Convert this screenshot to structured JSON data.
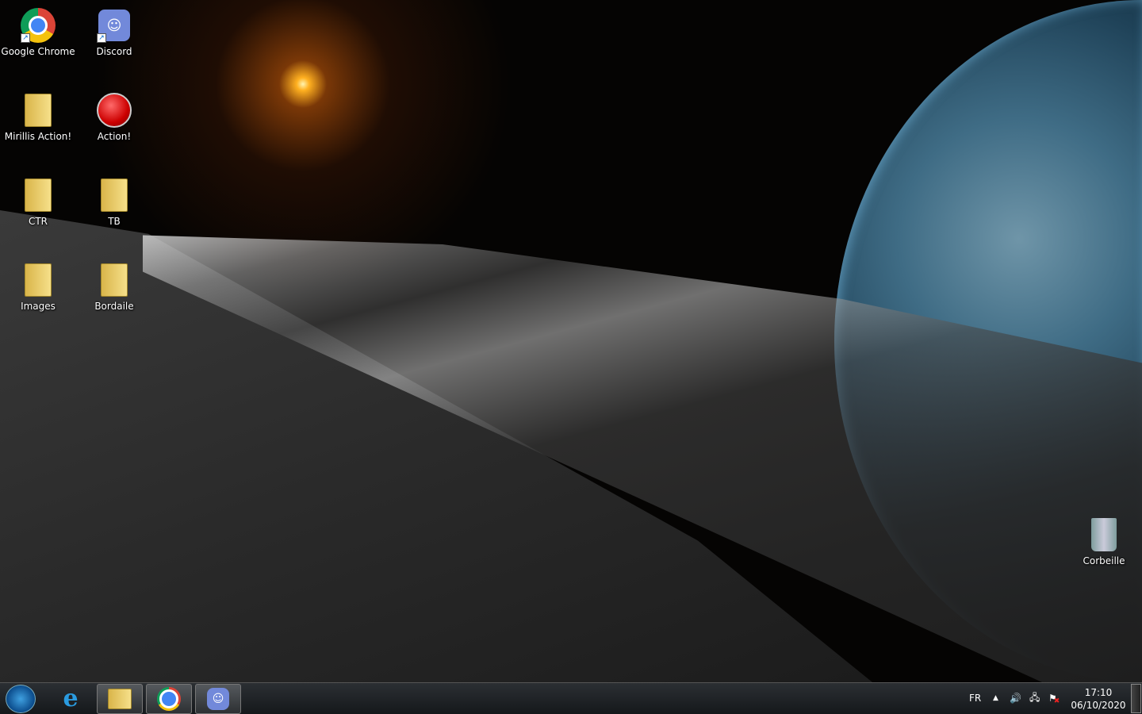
{
  "desktop": {
    "icons": [
      {
        "label": "Google Chrome",
        "icon": "chrome-icon"
      },
      {
        "label": "Discord",
        "icon": "discord-icon"
      },
      {
        "label": "Mirillis Action!",
        "icon": "folder-icon"
      },
      {
        "label": "Action!",
        "icon": "action-icon"
      },
      {
        "label": "CTR",
        "icon": "folder-icon"
      },
      {
        "label": "TB",
        "icon": "folder-icon"
      },
      {
        "label": "Images",
        "icon": "folder-icon"
      },
      {
        "label": "Bordaile",
        "icon": "folder-icon"
      },
      {
        "label": "Corbeille",
        "icon": "recycle-bin-icon"
      }
    ]
  },
  "taskbar": {
    "language": "FR",
    "time": "17:10",
    "date": "06/10/2020",
    "tray_arrow": "▲",
    "volume": "🔊",
    "network": "🖧",
    "flag": "⚑",
    "discord_glyph": "☺",
    "ie_glyph": "e"
  }
}
